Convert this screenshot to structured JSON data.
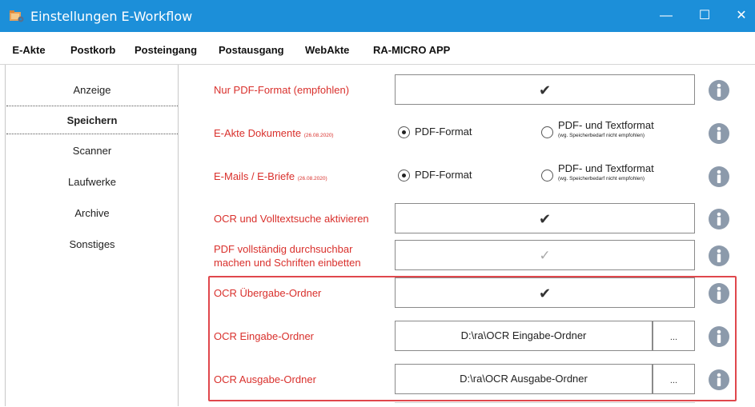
{
  "window": {
    "title": "Einstellungen E-Workflow",
    "minimize": "—",
    "maximize": "☐",
    "close": "✕",
    "icon": "folder-gear-icon"
  },
  "tabs": [
    {
      "label": "E-Akte",
      "active": true
    },
    {
      "label": "Postkorb"
    },
    {
      "label": "Posteingang"
    },
    {
      "label": "Postausgang"
    },
    {
      "label": "WebAkte"
    },
    {
      "label": "RA-MICRO APP"
    }
  ],
  "sidebar": {
    "items": [
      {
        "label": "Anzeige"
      },
      {
        "label": "Speichern",
        "active": true
      },
      {
        "label": "Scanner"
      },
      {
        "label": "Laufwerke"
      },
      {
        "label": "Archive"
      },
      {
        "label": "Sonstiges"
      }
    ]
  },
  "settings": {
    "pdf_only": {
      "label": "Nur PDF-Format (empfohlen)",
      "checked": true,
      "mark": "✔"
    },
    "eakte_docs": {
      "label": "E-Akte Dokumente",
      "date": "(26.08.2020)",
      "option1": "PDF-Format",
      "option2": "PDF- und Textformat",
      "option2_note": "(wg. Speicherbedarf nicht empfohlen)",
      "selected": "PDF-Format"
    },
    "emails": {
      "label": "E-Mails / E-Briefe",
      "date": "(26.08.2020)",
      "option1": "PDF-Format",
      "option2": "PDF- und Textformat",
      "option2_note": "(wg. Speicherbedarf nicht empfohlen)",
      "selected": "PDF-Format"
    },
    "ocr_fulltext": {
      "label": "OCR und Volltextsuche aktivieren",
      "checked": true,
      "mark": "✔"
    },
    "pdf_searchable": {
      "label_line1": "PDF vollständig durchsuchbar",
      "label_line2": "machen und Schriften einbetten",
      "checked": true,
      "disabled": true,
      "mark": "✓"
    },
    "ocr_transfer": {
      "label": "OCR Übergabe-Ordner",
      "checked": true,
      "mark": "✔"
    },
    "ocr_input": {
      "label": "OCR Eingabe-Ordner",
      "value": "D:\\ra\\OCR Eingabe-Ordner",
      "browse": "..."
    },
    "ocr_output": {
      "label": "OCR Ausgabe-Ordner",
      "value": "D:\\ra\\OCR Ausgabe-Ordner",
      "browse": "..."
    }
  },
  "colors": {
    "titlebar": "#1c8fd9",
    "label_red": "#d9302c",
    "info_icon": "#8c9aab",
    "highlight_border": "#e0474c"
  }
}
